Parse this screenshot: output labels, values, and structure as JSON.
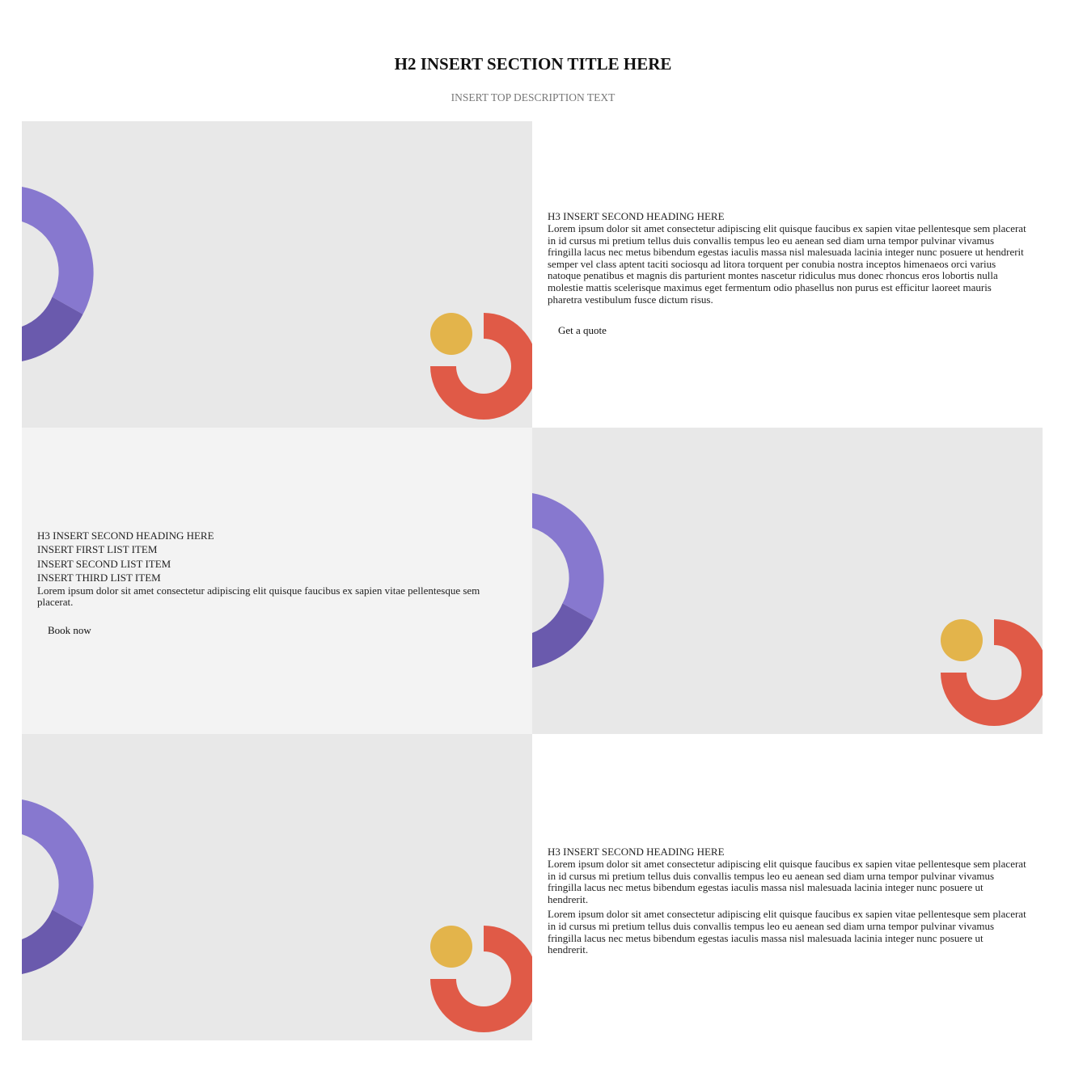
{
  "section": {
    "title": "H2 INSERT SECTION TITLE HERE",
    "description": "INSERT TOP DESCRIPTION TEXT"
  },
  "colors": {
    "panel_gray": "#e8e8e8",
    "panel_light": "#f3f3f3",
    "ring_purple_light": "#8778cf",
    "ring_purple_dark": "#6a5aad",
    "dot_yellow": "#e3b44b",
    "ring_red": "#e05a47"
  },
  "rows": [
    {
      "heading": "H3 INSERT SECOND HEADING HERE",
      "paragraph": "Lorem ipsum dolor sit amet consectetur adipiscing elit quisque faucibus ex sapien vitae pellentesque sem placerat in id cursus mi pretium tellus duis convallis tempus leo eu aenean sed diam urna tempor pulvinar vivamus fringilla lacus nec metus bibendum egestas iaculis massa nisl malesuada lacinia integer nunc posuere ut hendrerit semper vel class aptent taciti sociosqu ad litora torquent per conubia nostra inceptos himenaeos orci varius natoque penatibus et magnis dis parturient montes nascetur ridiculus mus donec rhoncus eros lobortis nulla molestie mattis scelerisque maximus eget fermentum odio phasellus non purus est efficitur laoreet mauris pharetra vestibulum fusce dictum risus.",
      "button": "Get a quote"
    },
    {
      "heading": "H3 INSERT SECOND HEADING HERE",
      "list": [
        "INSERT FIRST LIST ITEM",
        "INSERT SECOND LIST ITEM",
        "INSERT THIRD LIST ITEM"
      ],
      "paragraph": "Lorem ipsum dolor sit amet consectetur adipiscing elit quisque faucibus ex sapien vitae pellentesque sem placerat.",
      "button": "Book now"
    },
    {
      "heading": "H3 INSERT SECOND HEADING HERE",
      "paragraph1": "Lorem ipsum dolor sit amet consectetur adipiscing elit quisque faucibus ex sapien vitae pellentesque sem placerat in id cursus mi pretium tellus duis convallis tempus leo eu aenean sed diam urna tempor pulvinar vivamus fringilla lacus nec metus bibendum egestas iaculis massa nisl malesuada lacinia integer nunc posuere ut hendrerit.",
      "paragraph2": "Lorem ipsum dolor sit amet consectetur adipiscing elit quisque faucibus ex sapien vitae pellentesque sem placerat in id cursus mi pretium tellus duis convallis tempus leo eu aenean sed diam urna tempor pulvinar vivamus fringilla lacus nec metus bibendum egestas iaculis massa nisl malesuada lacinia integer nunc posuere ut hendrerit."
    }
  ]
}
